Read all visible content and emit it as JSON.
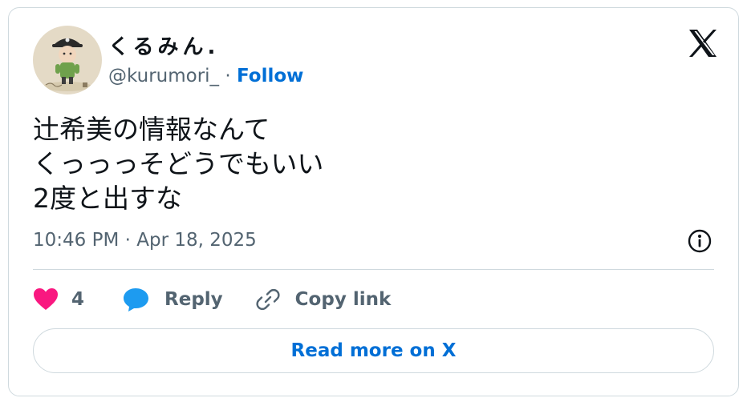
{
  "author": {
    "display_name": "くるみん.",
    "handle": "@kurumori_",
    "separator": " · ",
    "follow_label": "Follow"
  },
  "tweet": {
    "text": "辻希美の情報なんて\nくっっっそどうでもいい\n2度と出すな",
    "timestamp": "10:46 PM · Apr 18, 2025"
  },
  "actions": {
    "like_count": "4",
    "reply_label": "Reply",
    "copy_link_label": "Copy link"
  },
  "footer": {
    "read_more_label": "Read more on X"
  },
  "colors": {
    "accent": "#006fd6",
    "like": "#f91880",
    "reply": "#1d9bf0",
    "text_primary": "#0f1419",
    "text_secondary": "#536471",
    "border": "#cfd9de"
  },
  "icons": [
    "avatar-image",
    "x-logo-icon",
    "info-icon",
    "heart-icon",
    "reply-bubble-icon",
    "link-icon"
  ]
}
